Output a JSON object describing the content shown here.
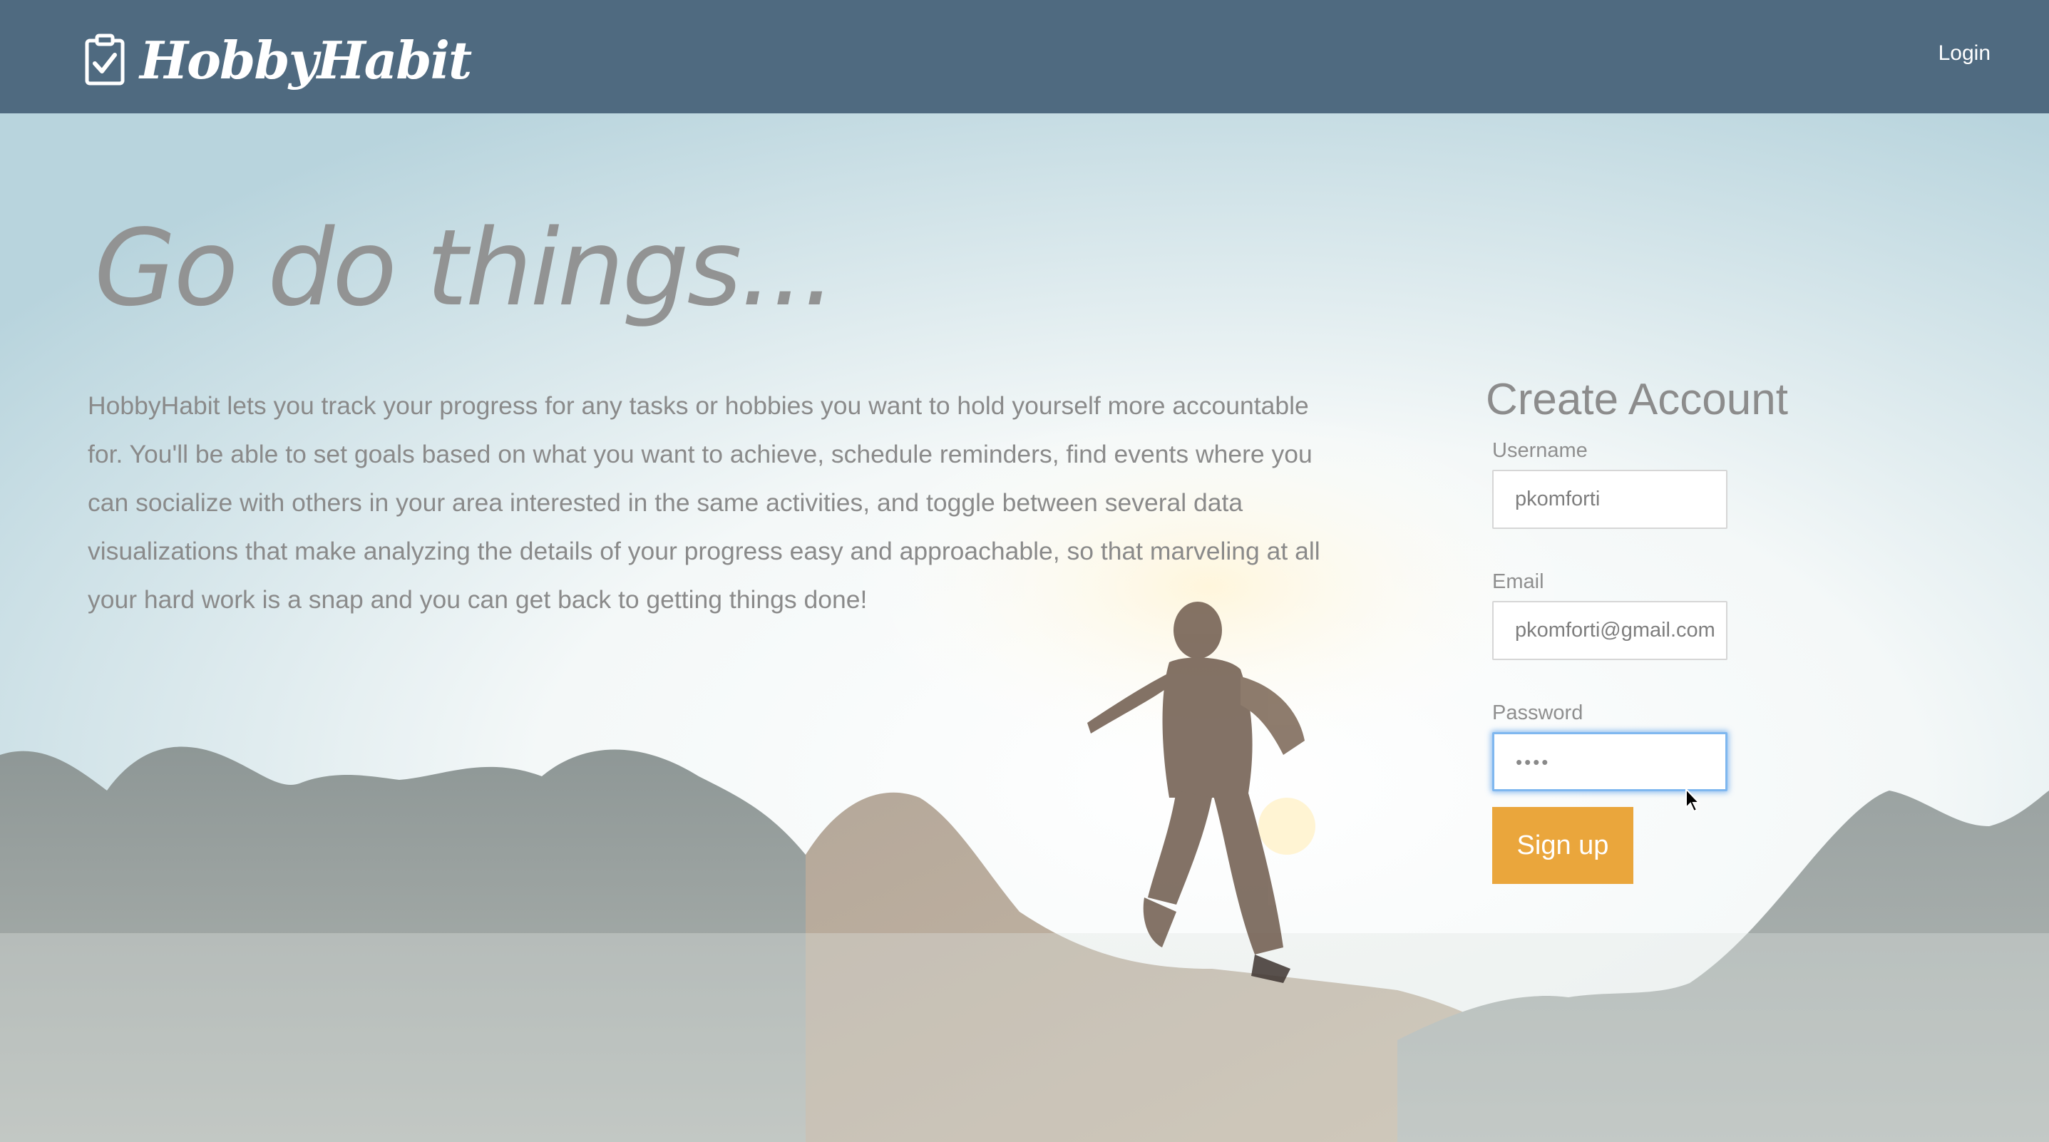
{
  "nav": {
    "brand_name": "HobbyHabit",
    "brand_icon": "clipboard-check-icon",
    "login_label": "Login",
    "background_color": "#4f6a80"
  },
  "hero": {
    "headline": "Go do things...",
    "description": "HobbyHabit lets you track your progress for any tasks or hobbies you want to hold yourself more accountable for. You'll be able to set goals based on what you want to achieve, schedule reminders, find events where you can socialize with others in your area interested in the same activities, and toggle between several data visualizations that make analyzing the details of your progress easy and approachable, so that marveling at all your hard work is a snap and you can get back to getting things done!"
  },
  "signup": {
    "title": "Create Account",
    "username": {
      "label": "Username",
      "value": "pkomforti"
    },
    "email": {
      "label": "Email",
      "value": "pkomforti@gmail.com"
    },
    "password": {
      "label": "Password",
      "value": "••••"
    },
    "button_label": "Sign up",
    "button_color": "#eaa63c"
  }
}
